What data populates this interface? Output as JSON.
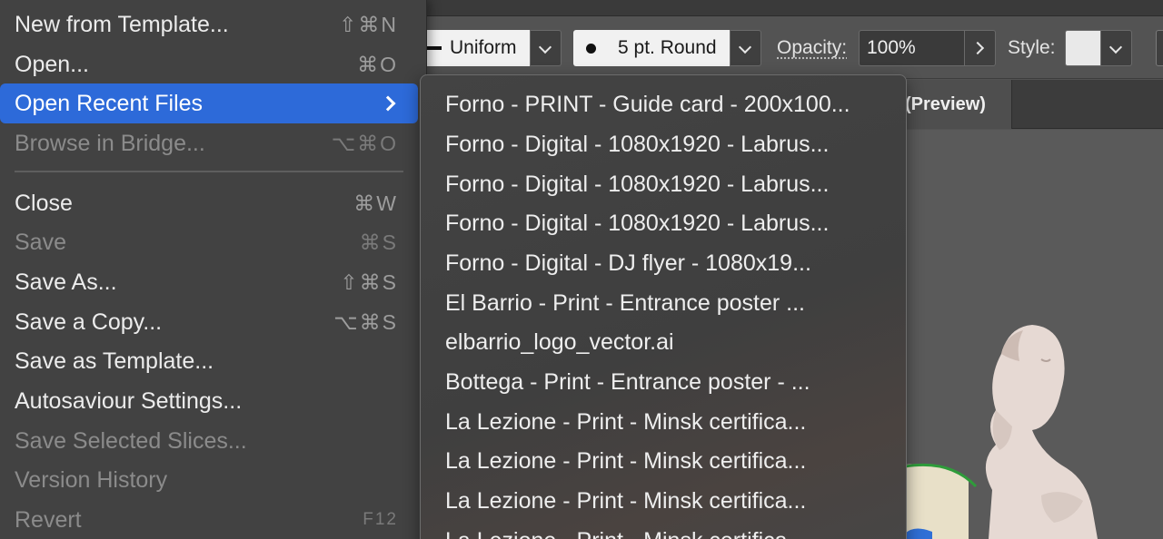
{
  "control_bar": {
    "stroke_profile": "Uniform",
    "brush": "5 pt. Round",
    "opacity_label": "Opacity:",
    "opacity_value": "100%",
    "style_label": "Style:"
  },
  "document_tab": {
    "title": "(Preview)"
  },
  "file_menu": {
    "items": [
      {
        "label": "New from Template...",
        "shortcut": "⇧⌘N",
        "enabled": true
      },
      {
        "label": "Open...",
        "shortcut": "⌘O",
        "enabled": true
      },
      {
        "label": "Open Recent Files",
        "shortcut": "",
        "enabled": true,
        "highlighted": true,
        "submenu": true
      },
      {
        "label": "Browse in Bridge...",
        "shortcut": "⌥⌘O",
        "enabled": false
      },
      {
        "label": "Close",
        "shortcut": "⌘W",
        "enabled": true
      },
      {
        "label": "Save",
        "shortcut": "⌘S",
        "enabled": false
      },
      {
        "label": "Save As...",
        "shortcut": "⇧⌘S",
        "enabled": true
      },
      {
        "label": "Save a Copy...",
        "shortcut": "⌥⌘S",
        "enabled": true
      },
      {
        "label": "Save as Template...",
        "shortcut": "",
        "enabled": true
      },
      {
        "label": "Autosaviour Settings...",
        "shortcut": "",
        "enabled": true
      },
      {
        "label": "Save Selected Slices...",
        "shortcut": "",
        "enabled": false
      },
      {
        "label": "Version History",
        "shortcut": "",
        "enabled": false
      },
      {
        "label": "Revert",
        "shortcut": "F12",
        "enabled": false
      }
    ]
  },
  "recent_files": [
    "Forno - PRINT - Guide card - 200x100...",
    "Forno - Digital - 1080x1920 - Labrus...",
    "Forno - Digital - 1080x1920 - Labrus...",
    "Forno - Digital - 1080x1920 - Labrus...",
    "Forno - Digital - DJ flyer - 1080x19...",
    "El Barrio - Print - Entrance poster ...",
    "elbarrio_logo_vector.ai",
    "Bottega - Print - Entrance poster - ...",
    "La Lezione - Print - Minsk certifica...",
    "La Lezione - Print - Minsk certifica...",
    "La Lezione - Print - Minsk certifica...",
    "La Lezione - Print - Minsk certifica..."
  ],
  "colors": {
    "menu_bg": "#424242",
    "highlight": "#2d6ad9",
    "disabled_text": "#8b8b8b",
    "app_bg": "#535353"
  },
  "icons": [
    "chevron-down-icon",
    "chevron-right-icon",
    "brush-dot-icon",
    "submenu-arrow-icon"
  ]
}
